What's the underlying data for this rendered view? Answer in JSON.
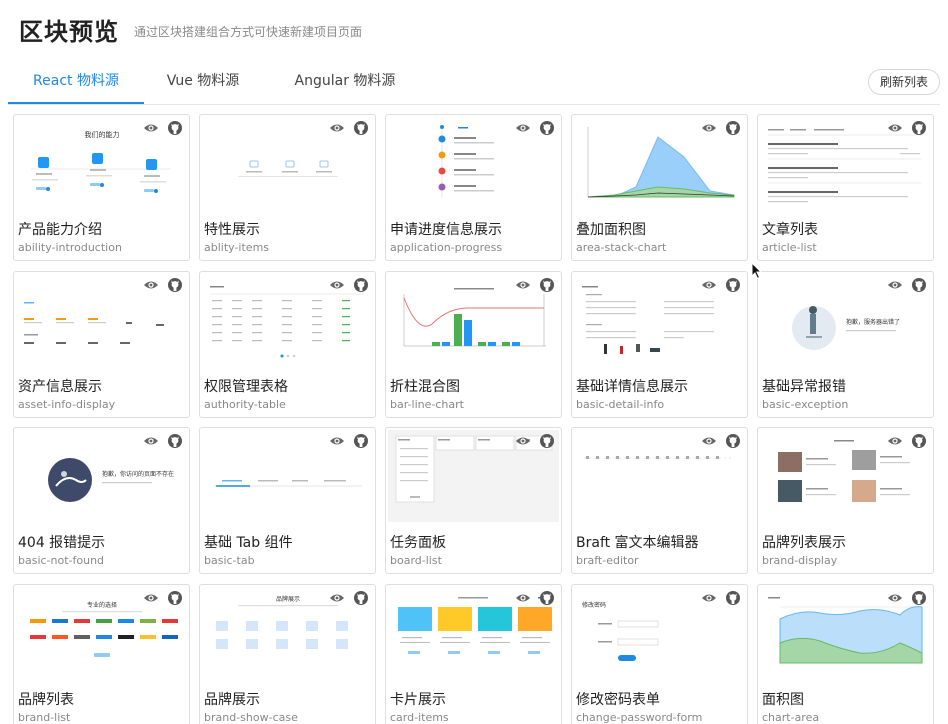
{
  "header": {
    "title": "区块预览",
    "subtitle": "通过区块搭建组合方式可快速新建项目页面"
  },
  "tabs": [
    {
      "label": "React 物料源",
      "active": true
    },
    {
      "label": "Vue 物料源",
      "active": false
    },
    {
      "label": "Angular 物料源",
      "active": false
    }
  ],
  "refresh_label": "刷新列表",
  "colors": {
    "accent": "#1e88e5",
    "border": "#dedede"
  },
  "cards": [
    {
      "title": "产品能力介绍",
      "key": "ability-introduction",
      "thumb_text": "我们的能力",
      "thumb_sub": "Ability description"
    },
    {
      "title": "特性展示",
      "key": "ablity-items"
    },
    {
      "title": "申请进度信息展示",
      "key": "application-progress"
    },
    {
      "title": "叠加面积图",
      "key": "area-stack-chart"
    },
    {
      "title": "文章列表",
      "key": "article-list"
    },
    {
      "title": "资产信息展示",
      "key": "asset-info-display"
    },
    {
      "title": "权限管理表格",
      "key": "authority-table"
    },
    {
      "title": "折柱混合图",
      "key": "bar-line-chart"
    },
    {
      "title": "基础详情信息展示",
      "key": "basic-detail-info"
    },
    {
      "title": "基础异常报错",
      "key": "basic-exception",
      "thumb_text": "抱歉，服务器出错了"
    },
    {
      "title": "404 报错提示",
      "key": "basic-not-found",
      "thumb_text": "抱歉，你访问的页面不存在"
    },
    {
      "title": "基础 Tab 组件",
      "key": "basic-tab"
    },
    {
      "title": "任务面板",
      "key": "board-list"
    },
    {
      "title": "Braft 富文本编辑器",
      "key": "braft-editor"
    },
    {
      "title": "品牌列表展示",
      "key": "brand-display"
    },
    {
      "title": "品牌列表",
      "key": "brand-list",
      "thumb_text": "专业的选择"
    },
    {
      "title": "品牌展示",
      "key": "brand-show-case",
      "thumb_text": "品牌展示"
    },
    {
      "title": "卡片展示",
      "key": "card-items"
    },
    {
      "title": "修改密码表单",
      "key": "change-password-form",
      "thumb_text": "修改密码"
    },
    {
      "title": "面积图",
      "key": "chart-area"
    }
  ]
}
